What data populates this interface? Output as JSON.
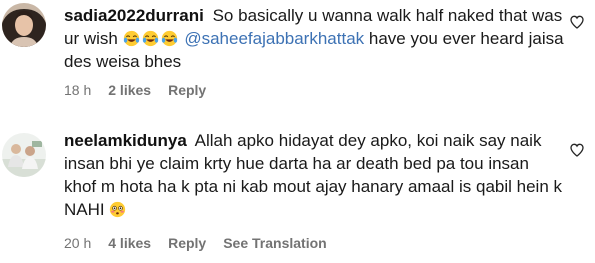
{
  "comments": [
    {
      "username": "sadia2022durrani",
      "text_before": "So basically u wanna walk half naked that was ur wish",
      "emojis": [
        "tears-of-joy",
        "tears-of-joy",
        "tears-of-joy"
      ],
      "mention": "@saheefajabbarkhattak",
      "text_after": "have you ever heard jaisa des weisa bhes",
      "time": "18 h",
      "likes": "2 likes",
      "reply": "Reply"
    },
    {
      "username": "neelamkidunya",
      "text": "Allah apko hidayat dey apko, koi naik say naik insan bhi ye claim krty hue darta ha ar death bed pa tou insan khof m hota ha k pta ni kab mout ajay hanary amaal is qabil hein k NAHI",
      "emoji": "flushed-face",
      "time": "20 h",
      "likes": "4 likes",
      "reply": "Reply",
      "see_translation": "See Translation"
    }
  ],
  "icons": {
    "like": "heart-outline-icon"
  },
  "colors": {
    "mention": "#3d72b4",
    "meta": "#737373",
    "text": "#1a1a1a"
  }
}
